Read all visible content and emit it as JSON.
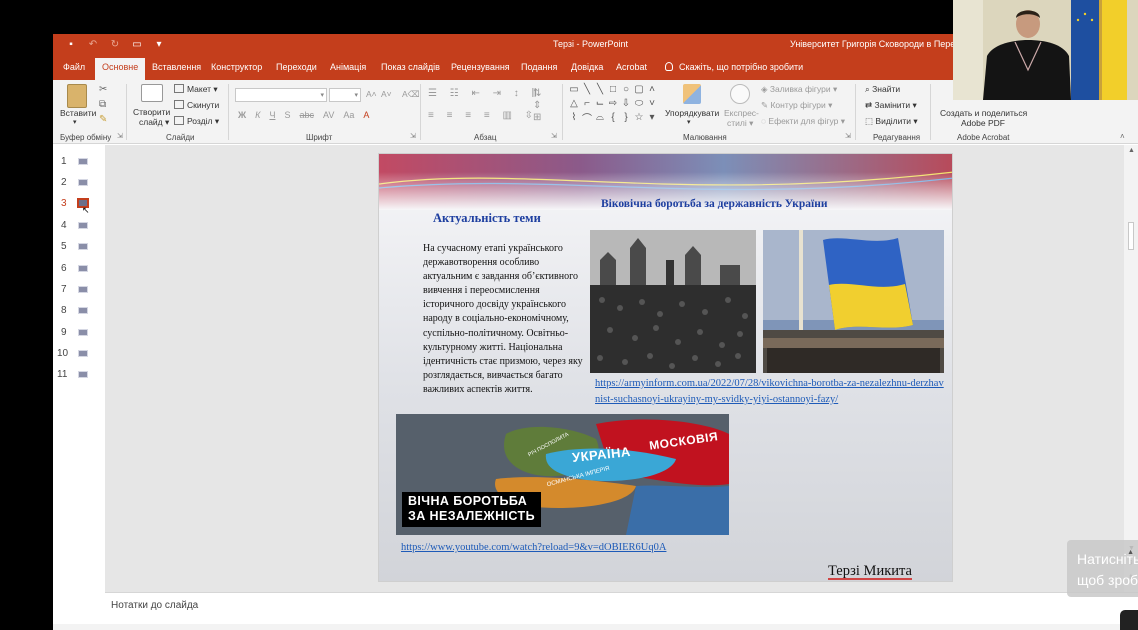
{
  "titlebar": {
    "title": "Терзі - PowerPoint",
    "account": "Університет Григорія Сковороди в Переяславі"
  },
  "tabs": [
    "Файл",
    "Основне",
    "Вставлення",
    "Конструктор",
    "Переходи",
    "Анімація",
    "Показ слайдів",
    "Рецензування",
    "Подання",
    "Довідка",
    "Acrobat"
  ],
  "active_tab": "Основне",
  "tell_me": "Скажіть, що потрібно зробити",
  "ribbon": {
    "clipboard": {
      "paste": "Вставити",
      "label": "Буфер обміну"
    },
    "slides": {
      "new_slide_1": "Створити",
      "new_slide_2": "слайд",
      "layout": "Макет",
      "reset": "Скинути",
      "section": "Розділ",
      "label": "Слайди"
    },
    "font": {
      "label": "Шрифт",
      "bold": "Ж",
      "italic": "К",
      "underline": "Ч",
      "strike": "S",
      "shadow": "abc",
      "spacing": "AV",
      "case": "Aa"
    },
    "paragraph": {
      "label": "Абзац"
    },
    "drawing": {
      "arrange": "Упорядкувати",
      "quick_styles_1": "Експрес-",
      "quick_styles_2": "стилі",
      "fill": "Заливка фігури",
      "outline": "Контур фігури",
      "effects": "Ефекти для фігур",
      "label": "Малювання"
    },
    "editing": {
      "find": "Знайти",
      "replace": "Замінити",
      "select": "Виділити",
      "label": "Редагування"
    },
    "acrobat": {
      "btn_1": "Создать и поделиться",
      "btn_2": "Adobe PDF",
      "label": "Adobe Acrobat"
    }
  },
  "slides": [
    "1",
    "2",
    "3",
    "4",
    "5",
    "6",
    "7",
    "8",
    "9",
    "10",
    "11"
  ],
  "current_slide": 3,
  "slide": {
    "heading_left": "Актуальність теми",
    "heading_right": "Віковічна боротьба за державність України",
    "body": "На сучасному етапі українського державотворення особливо актуальним є завдання об’єктивного вивчення і переосмислення історичного досвіду українського народу в соціально-економічному, суспільно-політичному. Освітньо-культурному житті. Національна ідентичність стає призмою, через яку розглядається, вивчається багато важливих аспектів життя.",
    "link1": "https://armyinform.com.ua/2022/07/28/vikovichna-borotba-za-nezalezhnu-derzhavnist-suchasnoyi-ukrayiny-my-svidky-yiyi-ostannoyi-fazy/",
    "map_labels": [
      "МОСКОВІЯ",
      "УКРАЇНА",
      "РІЧ ПОСПОЛИТА",
      "ОСМАНСЬКА ІМПЕРІЯ"
    ],
    "map_caption_1": "ВІЧНА БОРОТЬБА",
    "map_caption_2": "ЗА НЕЗАЛЕЖНІСТЬ",
    "link2": "https://www.youtube.com/watch?reload=9&v=dOBIER6Uq0A",
    "author": "Терзі Микита"
  },
  "notes_placeholder": "Нотатки до слайда",
  "toast": {
    "line1": "Натисніть",
    "line2": "щоб зробити"
  },
  "colors": {
    "accent": "#c43e1c",
    "slide_title": "#1e3fa0",
    "link": "#1e5bb8"
  }
}
